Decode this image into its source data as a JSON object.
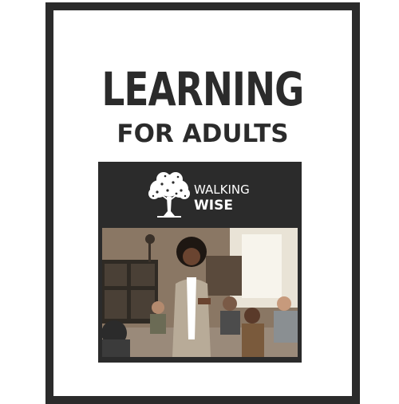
{
  "cover": {
    "title": "LEARNING",
    "subtitle": "FOR ADULTS"
  },
  "logo": {
    "line1": "WALKING",
    "line2": "WISE"
  },
  "photo": {
    "subject": "photo-of-adult-learning-classroom"
  },
  "colors": {
    "border": "#2b2b2b",
    "title": "#2b2b2b",
    "card": "#2b2b2b",
    "logo_text": "#ffffff"
  }
}
